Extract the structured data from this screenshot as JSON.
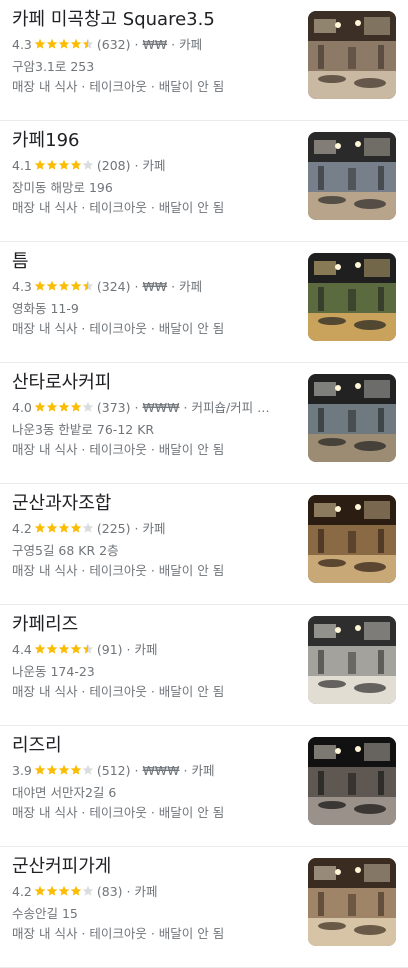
{
  "places": [
    {
      "name": "카페 미곡창고 Square3.5",
      "rating": "4.3",
      "stars": 4.5,
      "reviews": "(632)",
      "price": "₩₩",
      "category": "카페",
      "address": "구암3.1로 253",
      "services": "매장 내 식사 · 테이크아웃 · 배달이 안 됨"
    },
    {
      "name": "카페196",
      "rating": "4.1",
      "stars": 4,
      "reviews": "(208)",
      "price": "",
      "category": "카페",
      "address": "장미동 해망로 196",
      "services": "매장 내 식사 · 테이크아웃 · 배달이 안 됨"
    },
    {
      "name": "틈",
      "rating": "4.3",
      "stars": 4.5,
      "reviews": "(324)",
      "price": "₩₩",
      "category": "카페",
      "address": "영화동 11-9",
      "services": "매장 내 식사 · 테이크아웃 · 배달이 안 됨"
    },
    {
      "name": "산타로사커피",
      "rating": "4.0",
      "stars": 4,
      "reviews": "(373)",
      "price": "₩₩₩",
      "category": "커피숍/커피 …",
      "address": "나운3동 한밭로 76-12 KR",
      "services": "매장 내 식사 · 테이크아웃 · 배달이 안 됨"
    },
    {
      "name": "군산과자조합",
      "rating": "4.2",
      "stars": 4,
      "reviews": "(225)",
      "price": "",
      "category": "카페",
      "address": "구영5길 68 KR 2층",
      "services": "매장 내 식사 · 테이크아웃 · 배달이 안 됨"
    },
    {
      "name": "카페리즈",
      "rating": "4.4",
      "stars": 4.5,
      "reviews": "(91)",
      "price": "",
      "category": "카페",
      "address": "나운동 174-23",
      "services": "매장 내 식사 · 테이크아웃 · 배달이 안 됨"
    },
    {
      "name": "리즈리",
      "rating": "3.9",
      "stars": 4,
      "reviews": "(512)",
      "price": "₩₩₩",
      "category": "카페",
      "address": "대야면 서만자2길 6",
      "services": "매장 내 식사 · 테이크아웃 · 배달이 안 됨"
    },
    {
      "name": "군산커피가게",
      "rating": "4.2",
      "stars": 4,
      "reviews": "(83)",
      "price": "",
      "category": "카페",
      "address": "수송안길 15",
      "services": "매장 내 식사 · 테이크아웃 · 배달이 안 됨"
    }
  ],
  "colors": {
    "star": "#fbbc04",
    "star_empty": "#dadce0"
  }
}
